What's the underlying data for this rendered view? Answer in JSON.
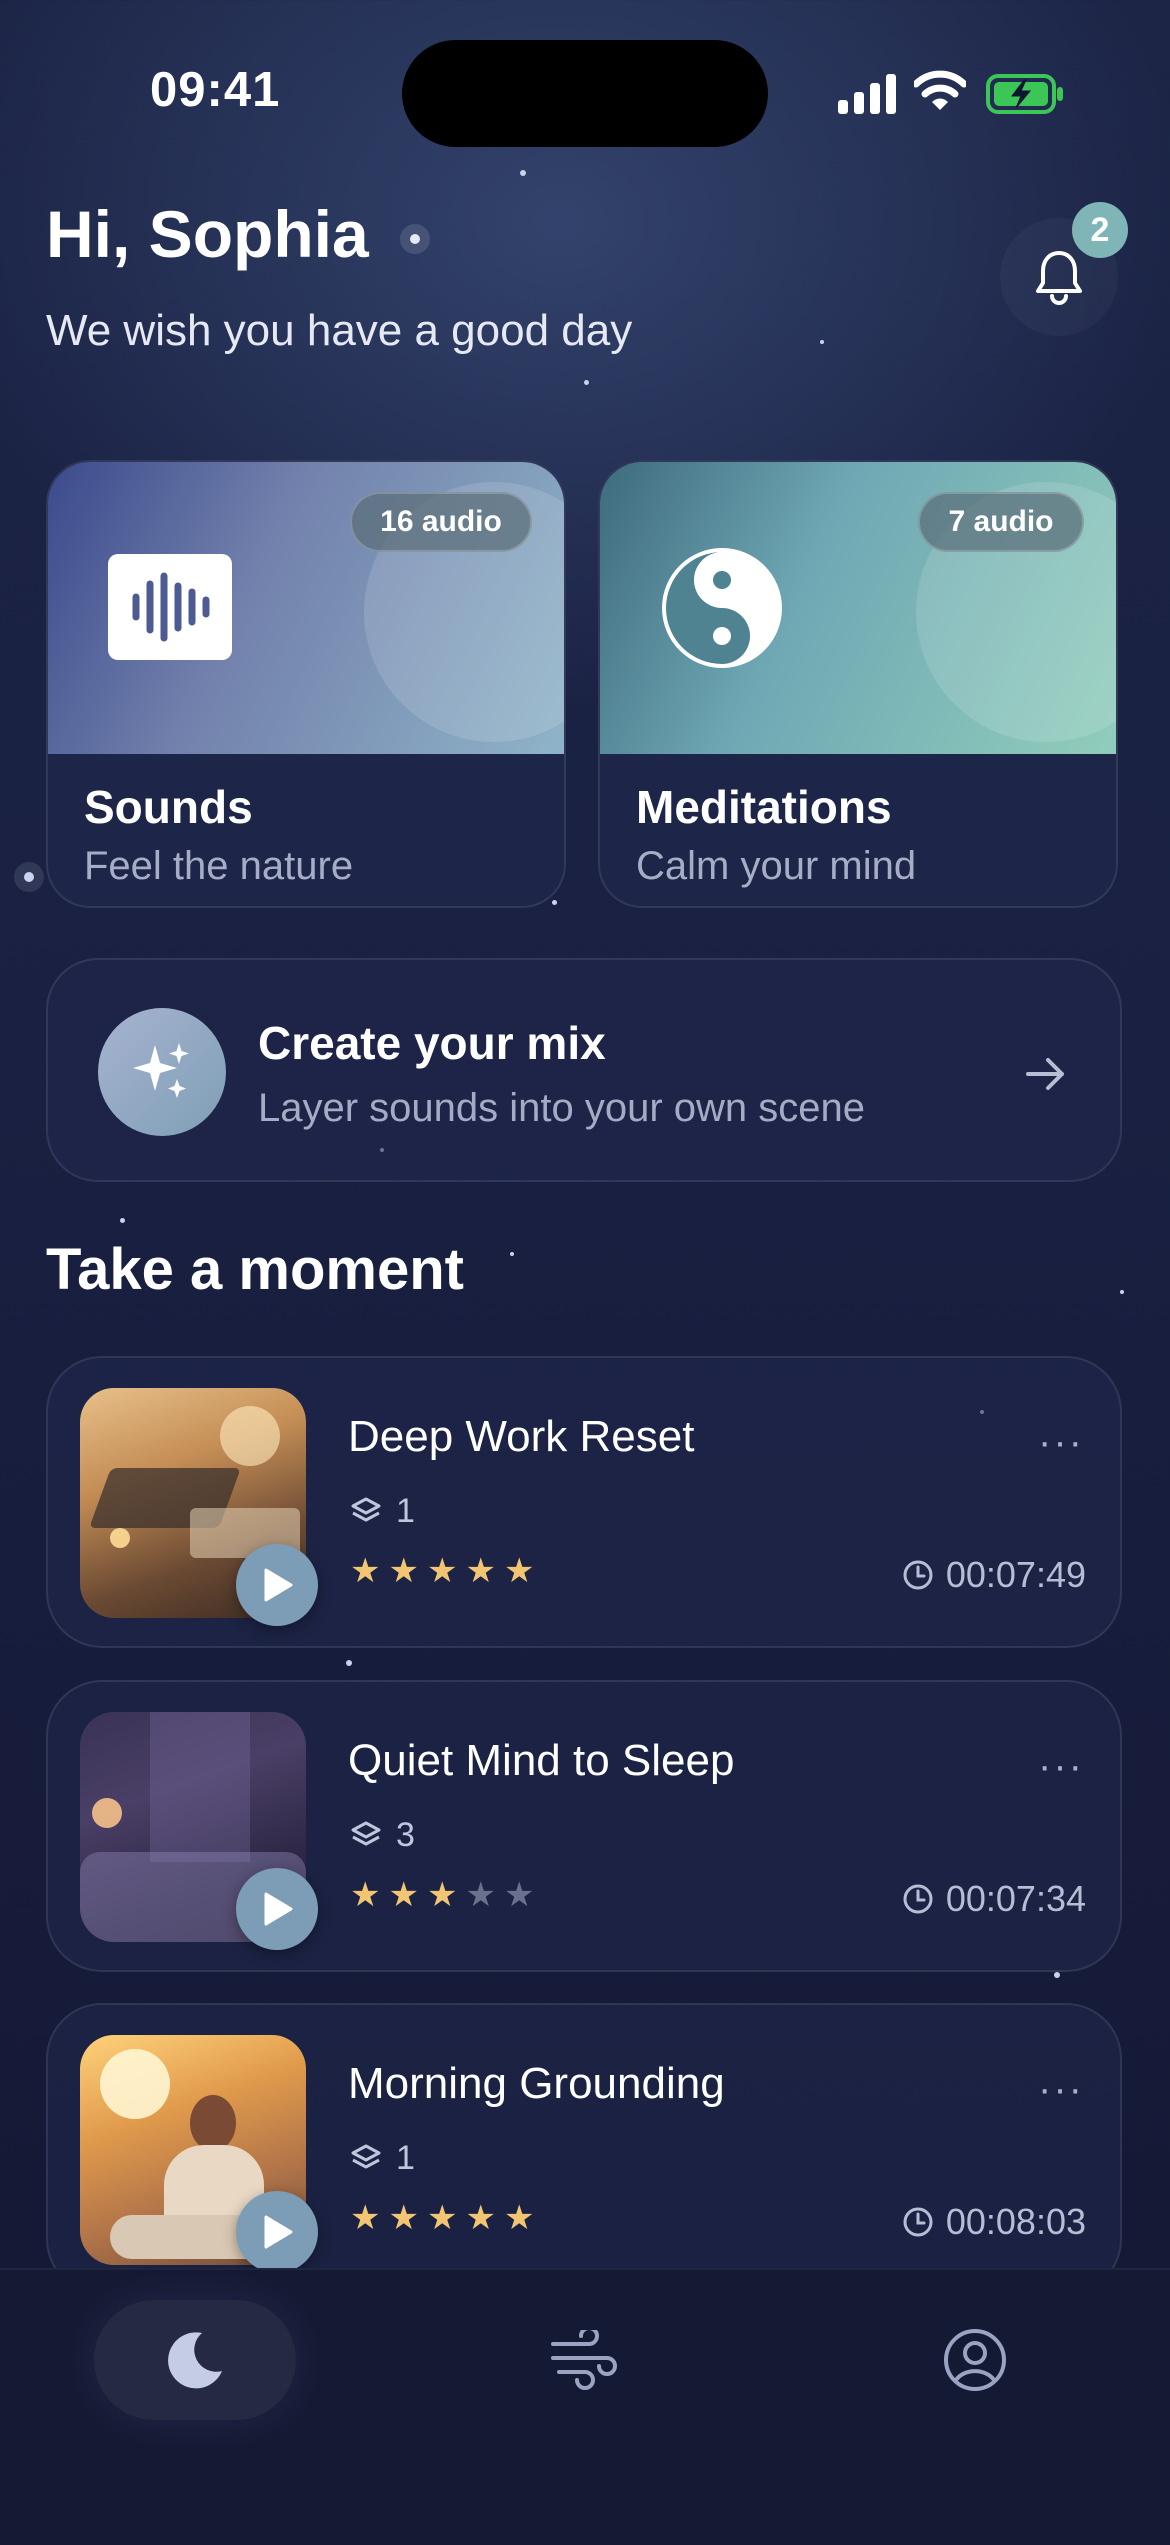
{
  "status_bar": {
    "time": "09:41"
  },
  "greeting": {
    "title": "Hi, Sophia",
    "subtitle": "We wish you have a good day"
  },
  "notifications": {
    "count": "2"
  },
  "categories": [
    {
      "title": "Sounds",
      "subtitle": "Feel the nature",
      "badge": "16 audio",
      "icon": "sound-wave-icon"
    },
    {
      "title": "Meditations",
      "subtitle": "Calm your mind",
      "badge": "7 audio",
      "icon": "yin-yang-icon"
    }
  ],
  "create_mix": {
    "title": "Create your mix",
    "subtitle": "Layer sounds into your own scene",
    "icon": "sparkles-icon"
  },
  "section_title": "Take a moment",
  "sessions": [
    {
      "title": "Deep Work Reset",
      "layers": "1",
      "rating": 5,
      "duration": "00:07:49"
    },
    {
      "title": "Quiet Mind to Sleep",
      "layers": "3",
      "rating": 3,
      "duration": "00:07:34"
    },
    {
      "title": "Morning Grounding",
      "layers": "1",
      "rating": 5,
      "duration": "00:08:03"
    }
  ],
  "tab_bar": {
    "tabs": [
      "moon-icon",
      "wind-icon",
      "profile-icon"
    ],
    "active": "moon-icon"
  },
  "colors": {
    "accent": "#7fb5b7",
    "star": "#f2c572",
    "background": "#1a2143"
  }
}
